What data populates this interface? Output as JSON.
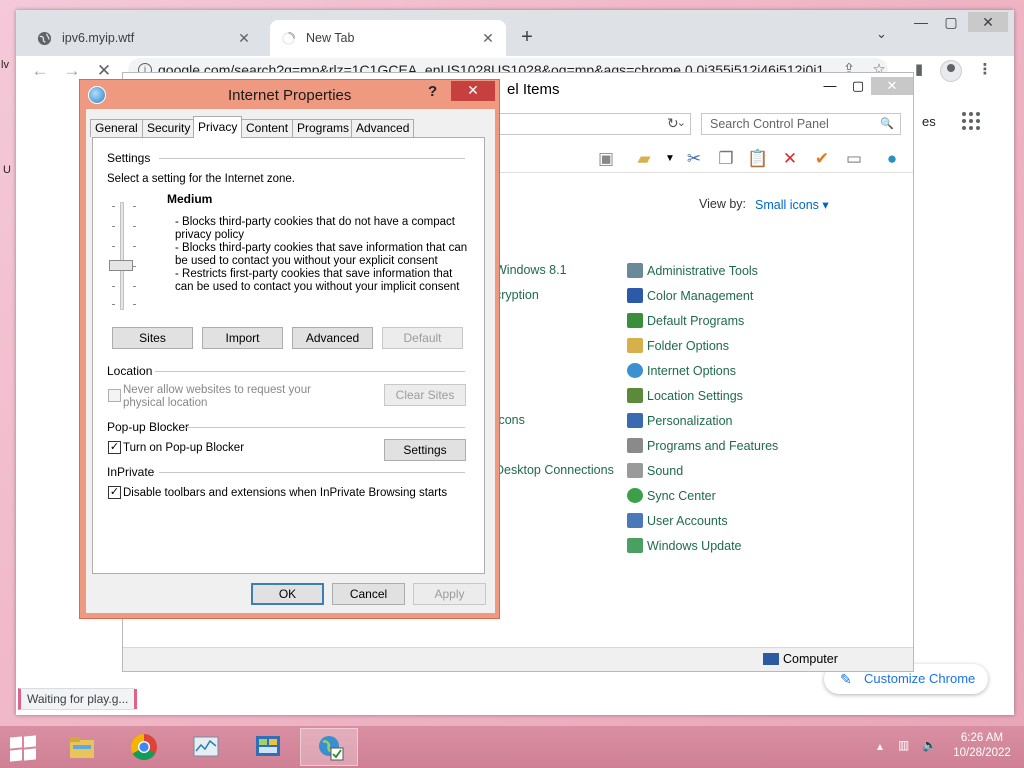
{
  "desktop": {
    "edge_marks": [
      "lv",
      "U"
    ]
  },
  "chrome": {
    "tabs": [
      {
        "title": "ipv6.myip.wtf",
        "icon": "globe-icon"
      },
      {
        "title": "New Tab",
        "icon": "loading-spinner-icon"
      }
    ],
    "new_tab": "+",
    "tab_menu": "⌄",
    "window_buttons": {
      "minimize": "—",
      "maximize": "▢",
      "close": "✕"
    },
    "url": "google.com/search?q=mp&rlz=1C1GCEA_enUS1028US1028&oq=mp&aqs=chrome.0.0i355i512j46i512i0i1",
    "page_partial_text": "es",
    "status_text": "Waiting for play.g...",
    "customize_label": "Customize Chrome"
  },
  "control_panel": {
    "title": "el Items",
    "window_buttons": {
      "minimize": "—",
      "maximize": "▢",
      "close": "✕"
    },
    "search_placeholder": "Search Control Panel",
    "view_by_label": "View by:",
    "view_by_value": "Small icons ▾",
    "left_items": [
      "Windows 8.1",
      "cryption",
      "Icons",
      "Desktop Connections"
    ],
    "right_items": [
      {
        "label": "Administrative Tools",
        "color": "#6a8a9a"
      },
      {
        "label": "Color Management",
        "color": "#2d5aa8"
      },
      {
        "label": "Default Programs",
        "color": "#3b8e3b"
      },
      {
        "label": "Folder Options",
        "color": "#d6b04a"
      },
      {
        "label": "Internet Options",
        "color": "#3c8fd0"
      },
      {
        "label": "Location Settings",
        "color": "#5a8a3a"
      },
      {
        "label": "Personalization",
        "color": "#3a6ab0"
      },
      {
        "label": "Programs and Features",
        "color": "#8a8a8a"
      },
      {
        "label": "Sound",
        "color": "#9a9a9a"
      },
      {
        "label": "Sync Center",
        "color": "#3ca04a"
      },
      {
        "label": "User Accounts",
        "color": "#4a78b8"
      },
      {
        "label": "Windows Update",
        "color": "#4aa060"
      }
    ],
    "status_computer": "Computer"
  },
  "dialog": {
    "title": "Internet Properties",
    "help": "?",
    "close": "✕",
    "tabs": [
      "General",
      "Security",
      "Privacy",
      "Content",
      "Programs",
      "Advanced"
    ],
    "active_tab": "Privacy",
    "settings_group": "Settings",
    "settings_prompt": "Select a setting for the Internet zone.",
    "level_name": "Medium",
    "level_description": [
      "- Blocks third-party cookies that do not have a compact",
      "privacy policy",
      "- Blocks third-party cookies that save information that can",
      "be used to contact you without your explicit consent",
      "- Restricts first-party cookies that save information that",
      "can be used to contact you without your implicit consent"
    ],
    "buttons": {
      "sites": "Sites",
      "import": "Import",
      "advanced": "Advanced",
      "default": "Default"
    },
    "location_group": "Location",
    "location_checkbox_line1": "Never allow websites to request your",
    "location_checkbox_line2": "physical location",
    "clear_sites": "Clear Sites",
    "popup_group": "Pop-up Blocker",
    "popup_checkbox": "Turn on Pop-up Blocker",
    "popup_settings": "Settings",
    "inprivate_group": "InPrivate",
    "inprivate_checkbox": "Disable toolbars and extensions when InPrivate Browsing starts",
    "ok": "OK",
    "cancel": "Cancel",
    "apply": "Apply",
    "check_mark": "✓"
  },
  "taskbar": {
    "time": "6:26 AM",
    "date": "10/28/2022"
  }
}
